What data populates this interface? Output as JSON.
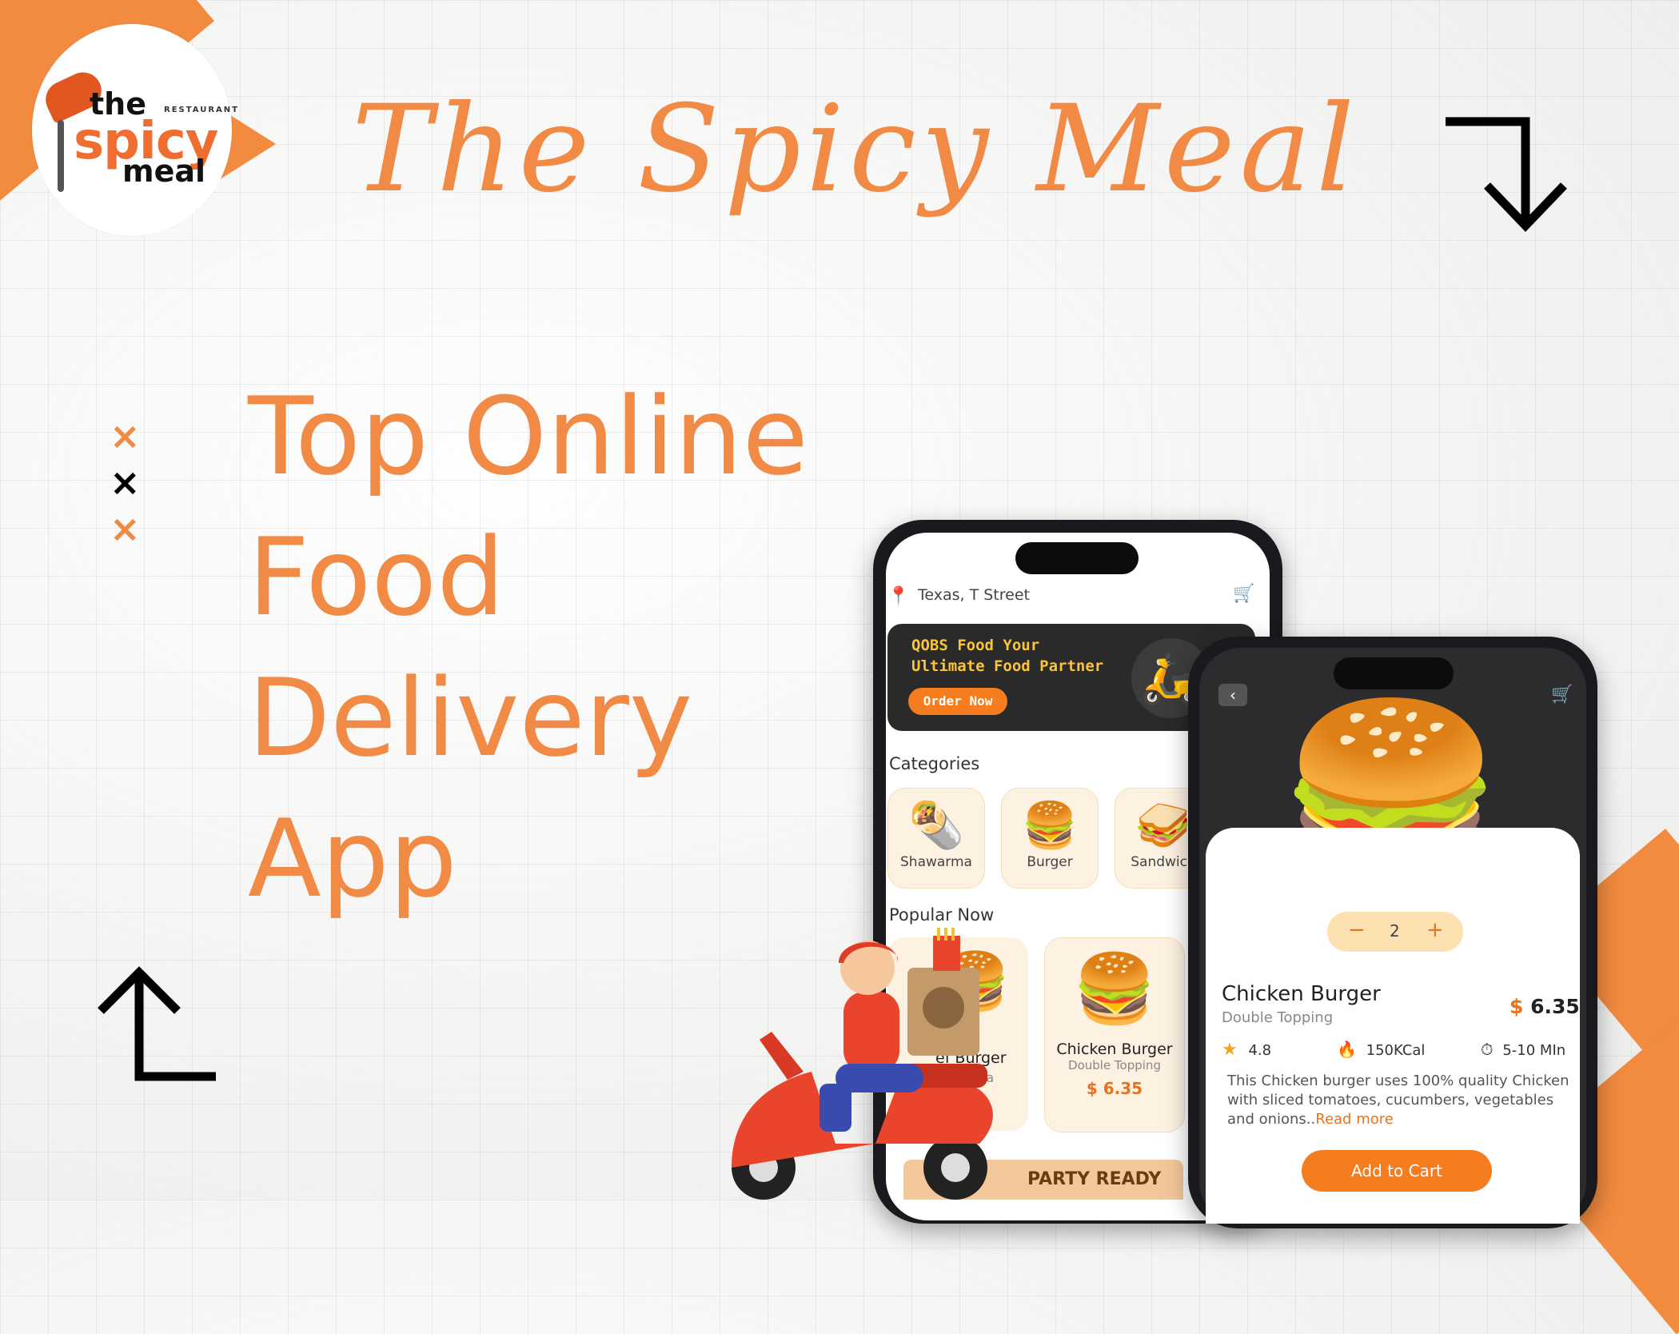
{
  "brand": {
    "logo_word_the": "the",
    "logo_word_spicy": "spicy",
    "logo_word_meal": "meal",
    "logo_tagline": "RESTAURANT",
    "title": "The Spicy Meal",
    "accent_color": "#f08a45"
  },
  "headline": {
    "line1": "Top Online",
    "line2": "Food",
    "line3": "Delivery",
    "line4": "App"
  },
  "decor": {
    "marks": [
      "×",
      "×",
      "×"
    ],
    "arrow_top_icon": "arrow-down-turn-icon",
    "arrow_bottom_icon": "arrow-up-turn-icon"
  },
  "phone_home": {
    "location": "Texas, T Street",
    "banner_title_line1": "QOBS Food Your",
    "banner_title_line2": "Ultimate Food Partner",
    "banner_button": "Order Now",
    "categories_title": "Categories",
    "categories": [
      {
        "label": "Shawarma",
        "icon": "🌯"
      },
      {
        "label": "Burger",
        "icon": "🍔"
      },
      {
        "label": "Sandwich",
        "icon": "🥪"
      }
    ],
    "popular_title": "Popular Now",
    "popular_left_name": "ef Burger",
    "popular_left_sub": "illa",
    "popular_item": {
      "name": "Chicken Burger",
      "sub": "Double Topping",
      "price": "$ 6.35"
    },
    "party_banner": "PARTY READY"
  },
  "phone_detail": {
    "quantity": "2",
    "minus": "−",
    "plus": "+",
    "name": "Chicken Burger",
    "sub": "Double Topping",
    "price_symbol": "$",
    "price": "6.35",
    "rating": "4.8",
    "calories": "150KCal",
    "time": "5-10 MIn",
    "description": "This Chicken burger uses 100% quality Chicken with sliced tomatoes, cucumbers, vegetables and onions..",
    "read_more": "Read more",
    "cta": "Add to Cart"
  }
}
